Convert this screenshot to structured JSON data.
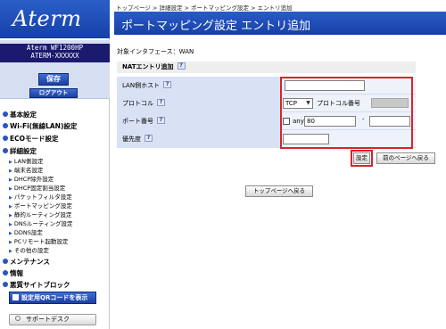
{
  "sidebar": {
    "logo": "Aterm",
    "model_name": "Aterm WF1200HP",
    "device_id": "ATERM-XXXXXX",
    "save_label": "保存",
    "logout_label": "ログアウト",
    "sections": [
      {
        "label": "基本設定"
      },
      {
        "label": "Wi-Fi(無線LAN)設定"
      },
      {
        "label": "ECOモード設定"
      },
      {
        "label": "詳細設定"
      }
    ],
    "detail_items": [
      "LAN側設定",
      "端末名設定",
      "DHCP除外設定",
      "DHCP固定割当設定",
      "パケットフィルタ設定",
      "ポートマッピング設定",
      "静的ルーティング設定",
      "DNSルーティング設定",
      "DDNS設定",
      "PCリモート起動設定",
      "その他の設定"
    ],
    "bottom_sections": [
      {
        "label": "メンテナンス"
      },
      {
        "label": "情報"
      },
      {
        "label": "悪質サイトブロック"
      }
    ],
    "qr_label": "設定用QRコードを表示",
    "support_label": "サポートデスク"
  },
  "header": {
    "breadcrumb": "トップページ > 詳細設定 > ポートマッピング設定 > エントリ追加",
    "title": "ポートマッピング設定 エントリ追加"
  },
  "main": {
    "interface_line": "対象インタフェース：WAN",
    "section_title": "NATエントリ追加",
    "help_glyph": "?",
    "rows": {
      "lan_host": {
        "label": "LAN側ホスト",
        "value": ""
      },
      "protocol": {
        "label": "プロトコル",
        "selected": "TCP",
        "number_label": "プロトコル番号"
      },
      "port": {
        "label": "ポート番号",
        "any_label": "any",
        "from": "80",
        "dash": "-",
        "to": ""
      },
      "priority": {
        "label": "優先度",
        "value": ""
      }
    },
    "set_label": "設定",
    "back_label": "前のページへ戻る",
    "top_label": "トップページへ戻る"
  }
}
